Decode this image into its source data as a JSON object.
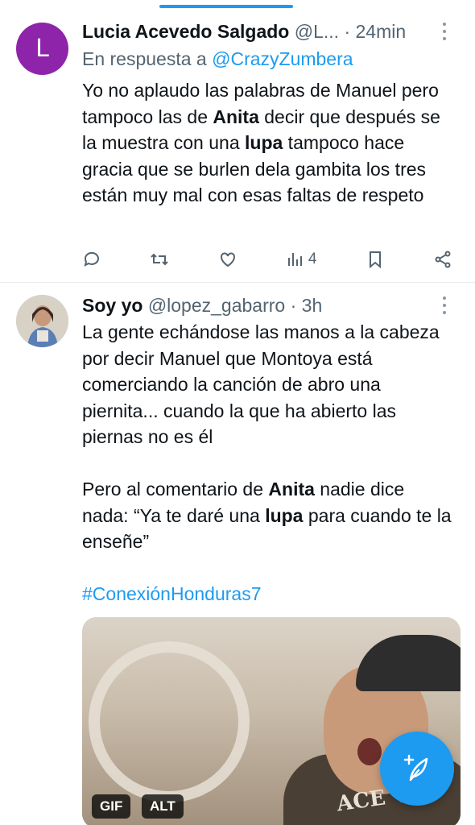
{
  "tweets": [
    {
      "author_name": "Lucia Acevedo Salgado",
      "handle": "@L...",
      "time": "24min",
      "avatar_letter": "L",
      "reply_prefix": "En respuesta a",
      "reply_mention": "@CrazyZumbera",
      "text_parts": [
        "Yo no aplaudo las palabras de Manuel pero tampoco las de ",
        "Anita",
        " decir que después se la muestra con una ",
        "lupa",
        " tampoco hace gracia que se burlen dela gambita los tres  están muy mal con esas faltas de respeto"
      ],
      "views_count": "4"
    },
    {
      "author_name": "Soy yo",
      "handle": "@lopez_gabarro",
      "time": "3h",
      "text_parts": [
        "La gente echándose las manos a la cabeza por decir Manuel que Montoya está comerciando la canción de abro una piernita... cuando la que ha abierto las piernas no es él\n\nPero al comentario de ",
        "Anita",
        " nadie dice nada: “Ya te daré una ",
        "lupa",
        " para cuando te la enseñe”"
      ],
      "hashtag": "#ConexiónHonduras7",
      "media_badges": [
        "GIF",
        "ALT"
      ],
      "media_shirt_text": "ACE VE"
    }
  ],
  "colors": {
    "accent": "#1d9bf0",
    "secondary_text": "#536471",
    "avatar_l": "#8e24aa"
  },
  "icons": {
    "reply": "reply-icon",
    "retweet": "retweet-icon",
    "like": "heart-icon",
    "views": "views-icon",
    "bookmark": "bookmark-icon",
    "share": "share-icon",
    "compose": "compose-icon"
  }
}
